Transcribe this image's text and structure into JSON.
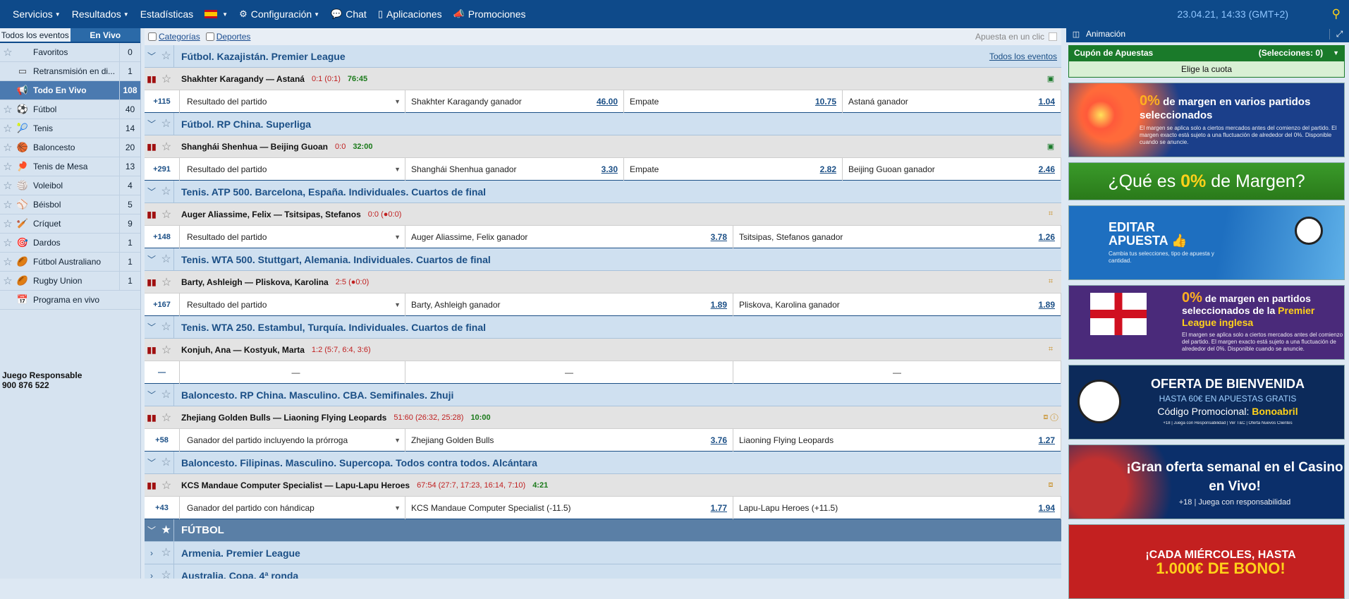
{
  "topbar": {
    "items": [
      "Servicios",
      "Resultados",
      "Estadísticas",
      "Configuración",
      "Chat",
      "Aplicaciones",
      "Promociones"
    ],
    "clock": "23.04.21, 14:33 (GMT+2)"
  },
  "sidebar": {
    "tabs": [
      "Todos los eventos",
      "En Vivo"
    ],
    "items": [
      {
        "label": "Favoritos",
        "count": "0"
      },
      {
        "label": "Retransmisión en di...",
        "count": "1"
      },
      {
        "label": "Todo En Vivo",
        "count": "108"
      },
      {
        "label": "Fútbol",
        "count": "40"
      },
      {
        "label": "Tenis",
        "count": "14"
      },
      {
        "label": "Baloncesto",
        "count": "20"
      },
      {
        "label": "Tenis de Mesa",
        "count": "13"
      },
      {
        "label": "Voleibol",
        "count": "4"
      },
      {
        "label": "Béisbol",
        "count": "5"
      },
      {
        "label": "Críquet",
        "count": "9"
      },
      {
        "label": "Dardos",
        "count": "1"
      },
      {
        "label": "Fútbol Australiano",
        "count": "1"
      },
      {
        "label": "Rugby Union",
        "count": "1"
      },
      {
        "label": "Programa en vivo",
        "count": ""
      }
    ],
    "responsible_line1": "Juego Responsable",
    "responsible_line2": "900 876 522"
  },
  "filters": {
    "categories": "Categorías",
    "sports": "Deportes",
    "one_click": "Apuesta en un clic"
  },
  "all_events": "Todos los eventos",
  "leagues": [
    {
      "title": "Fútbol. Kazajistán. Premier League",
      "event": "Shakhter Karagandy — Astaná",
      "score": "0:1 (0:1)",
      "time": "76:45",
      "plus": "+115",
      "market": "Resultado del partido",
      "outcomes": [
        {
          "label": "Shakhter Karagandy ganador",
          "odd": "46.00"
        },
        {
          "label": "Empate",
          "odd": "10.75"
        },
        {
          "label": "Astaná ganador",
          "odd": "1.04"
        }
      ]
    },
    {
      "title": "Fútbol. RP China. Superliga",
      "event": "Shanghái Shenhua — Beijing Guoan",
      "score": "0:0",
      "time": "32:00",
      "plus": "+291",
      "market": "Resultado del partido",
      "outcomes": [
        {
          "label": "Shanghái Shenhua ganador",
          "odd": "3.30"
        },
        {
          "label": "Empate",
          "odd": "2.82"
        },
        {
          "label": "Beijing Guoan ganador",
          "odd": "2.46"
        }
      ]
    },
    {
      "title": "Tenis. ATP 500. Barcelona, España. Individuales. Cuartos de final",
      "event": "Auger Aliassime, Felix — Tsitsipas, Stefanos",
      "score": "0:0 (●0:0)",
      "time": "",
      "plus": "+148",
      "market": "Resultado del partido",
      "outcomes": [
        {
          "label": "Auger Aliassime, Felix ganador",
          "odd": "3.78"
        },
        {
          "label": "Tsitsipas, Stefanos ganador",
          "odd": "1.26"
        }
      ]
    },
    {
      "title": "Tenis. WTA 500. Stuttgart, Alemania. Individuales. Cuartos de final",
      "event": "Barty, Ashleigh — Pliskova, Karolina",
      "score": "2:5 (●0:0)",
      "time": "",
      "plus": "+167",
      "market": "Resultado del partido",
      "outcomes": [
        {
          "label": "Barty, Ashleigh ganador",
          "odd": "1.89"
        },
        {
          "label": "Pliskova, Karolina ganador",
          "odd": "1.89"
        }
      ]
    },
    {
      "title": "Tenis. WTA 250. Estambul, Turquía. Individuales. Cuartos de final",
      "event": "Konjuh, Ana — Kostyuk, Marta",
      "score": "1:2 (5:7, 6:4, 3:6)",
      "time": "",
      "dash": "—"
    },
    {
      "title": "Baloncesto. RP China. Masculino. CBA. Semifinales. Zhuji",
      "event": "Zhejiang Golden Bulls — Liaoning Flying Leopards",
      "score": "51:60 (26:32, 25:28)",
      "time": "10:00",
      "plus": "+58",
      "market": "Ganador del partido incluyendo la prórroga",
      "outcomes": [
        {
          "label": "Zhejiang Golden Bulls",
          "odd": "3.76"
        },
        {
          "label": "Liaoning Flying Leopards",
          "odd": "1.27"
        }
      ]
    },
    {
      "title": "Baloncesto. Filipinas. Masculino. Supercopa. Todos contra todos. Alcántara",
      "event": "KCS Mandaue Computer Specialist — Lapu-Lapu Heroes",
      "score": "67:54 (27:7, 17:23, 16:14, 7:10)",
      "time": "4:21",
      "plus": "+43",
      "market": "Ganador del partido con hándicap",
      "outcomes": [
        {
          "label": "KCS Mandaue Computer Specialist  (-11.5)",
          "odd": "1.77"
        },
        {
          "label": "Lapu-Lapu Heroes  (+11.5)",
          "odd": "1.94"
        }
      ]
    }
  ],
  "section": "FÚTBOL",
  "sub_leagues": [
    "Armenia. Premier League",
    "Australia. Copa. 4ª ronda"
  ],
  "right": {
    "animation": "Animación",
    "coupon": "Cupón de Apuestas",
    "selections": "(Selecciones: 0)",
    "choose": "Elige la cuota",
    "banners": {
      "b1_pct": "0%",
      "b1_title": " de margen en varios partidos seleccionados",
      "b1_text": "El margen se aplica solo a ciertos mercados antes del comienzo del partido. El margen exacto está sujeto a una fluctuación de alrededor del 0%. Disponible cuando se anuncie.",
      "b2_a": "¿Qué es ",
      "b2_b": "0%",
      "b2_c": " de Margen?",
      "b3_title": "EDITAR APUESTA 👍",
      "b3_text": "Cambia tus selecciones, tipo de apuesta y cantidad.",
      "b4_pct": "0%",
      "b4_title": " de margen en partidos seleccionados de la ",
      "b4_hl": "Premier League inglesa",
      "b4_text": "El margen se aplica solo a ciertos mercados antes del comienzo del partido. El margen exacto está sujeto a una fluctuación de alrededor del 0%. Disponible cuando se anuncie.",
      "b5_title": "OFERTA DE BIENVENIDA",
      "b5_sub": "HASTA 60€ EN APUESTAS GRATIS",
      "b5_code": "Código Promocional: ",
      "b5_code_hl": "Bonoabril",
      "b5_text": "+18 | Juega con Responsabilidad | Ver T&C | Oferta Nuevos Clientes",
      "b6_title": "¡Gran oferta semanal en el Casino en Vivo!",
      "b6_text": "+18 | Juega con responsabilidad",
      "b7_title": "¡CADA MIÉRCOLES, HASTA",
      "b7_hl": "1.000€ DE BONO!"
    }
  }
}
